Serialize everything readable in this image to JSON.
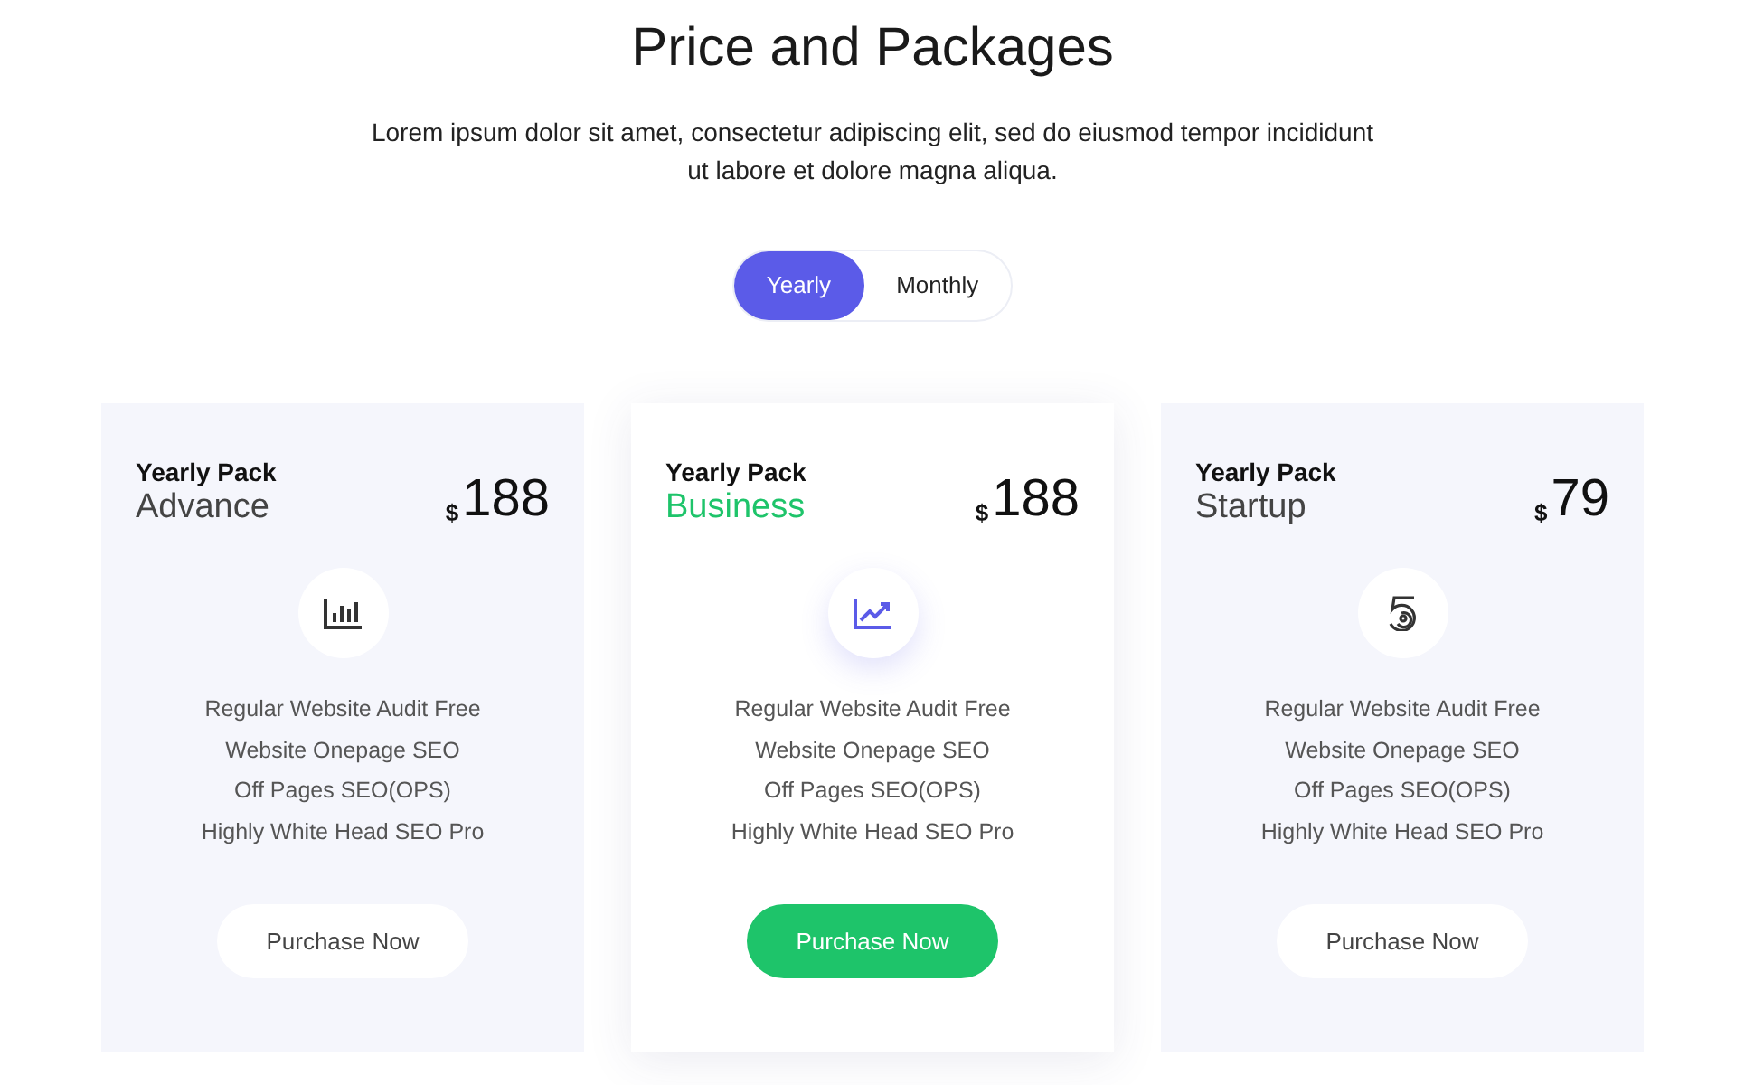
{
  "heading": {
    "title": "Price and Packages",
    "subtitle": "Lorem ipsum dolor sit amet, consectetur adipiscing elit, sed do eiusmod tempor incididunt ut labore et dolore magna aliqua."
  },
  "billing_tabs": [
    {
      "label": "Yearly",
      "selected": true
    },
    {
      "label": "Monthly",
      "selected": false
    }
  ],
  "plans": [
    {
      "pack": "Yearly Pack",
      "name": "Advance",
      "currency": "$",
      "price": "188",
      "featured": false,
      "features": [
        "Regular Website Audit Free",
        "Website Onepage SEO",
        "Off Pages SEO(OPS)",
        "Highly White Head SEO Pro"
      ],
      "button": "Purchase Now"
    },
    {
      "pack": "Yearly Pack",
      "name": "Business",
      "currency": "$",
      "price": "188",
      "featured": true,
      "features": [
        "Regular Website Audit Free",
        "Website Onepage SEO",
        "Off Pages SEO(OPS)",
        "Highly White Head SEO Pro"
      ],
      "button": "Purchase Now"
    },
    {
      "pack": "Yearly Pack",
      "name": "Startup",
      "currency": "$",
      "price": "79",
      "featured": false,
      "features": [
        "Regular Website Audit Free",
        "Website Onepage SEO",
        "Off Pages SEO(OPS)",
        "Highly White Head SEO Pro"
      ],
      "button": "Purchase Now"
    }
  ]
}
